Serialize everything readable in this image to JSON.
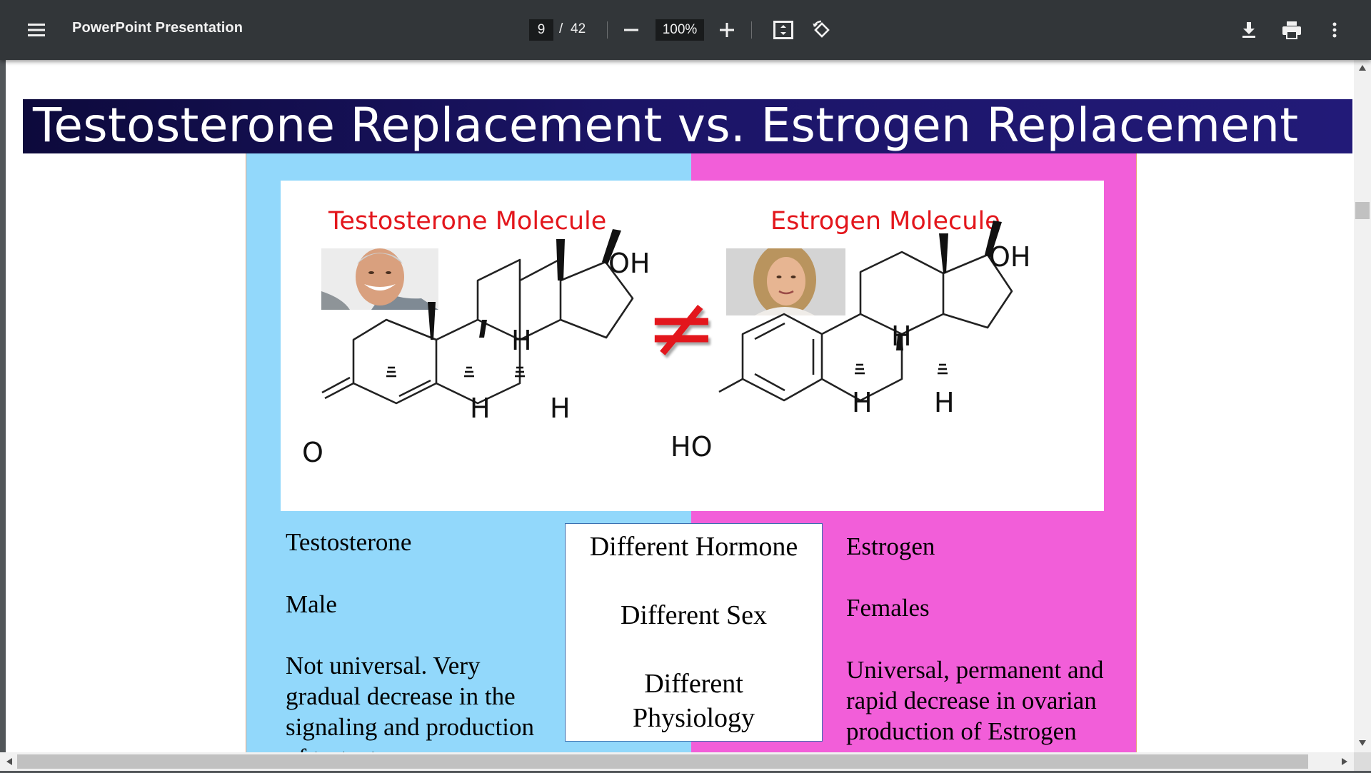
{
  "toolbar": {
    "menu_icon": "hamburger-menu-icon",
    "title": "PowerPoint Presentation",
    "page_current": "9",
    "page_separator": "/",
    "page_total": "42",
    "zoom": "100%",
    "zoom_out_icon": "minus-icon",
    "zoom_in_icon": "plus-icon",
    "fit_icon": "fit-to-page-icon",
    "rotate_icon": "rotate-icon",
    "download_icon": "download-icon",
    "print_icon": "print-icon",
    "more_icon": "more-vertical-icon"
  },
  "slide": {
    "title": "Testosterone Replacement vs. Estrogen Replacement",
    "left_molecule_label": "Testosterone Molecule",
    "right_molecule_label": "Estrogen Molecule",
    "not_equal_symbol": "≠",
    "atoms": {
      "oh": "OH",
      "h": "H",
      "o": "O",
      "ho": "HO"
    },
    "left_column": {
      "line1": "Testosterone",
      "line2": "Male",
      "line3a": "Not universal. Very",
      "line3b": "gradual decrease in the",
      "line3c": "signaling and production",
      "line3d": "of testosterone"
    },
    "center_box": {
      "line1": "Different Hormone",
      "line2": "Different Sex",
      "line3": "Different",
      "line4": "Physiology"
    },
    "right_column": {
      "line1": "Estrogen",
      "line2": "Females",
      "line3a": "Universal, permanent and",
      "line3b": "rapid decrease in ovarian",
      "line3c": "production of Estrogen"
    }
  },
  "colors": {
    "toolbar_bg": "#323639",
    "header_bg": "#1b1466",
    "blue_panel": "#92d8fb",
    "pink_panel": "#f25ed9",
    "molecule_label": "#e3161c"
  }
}
